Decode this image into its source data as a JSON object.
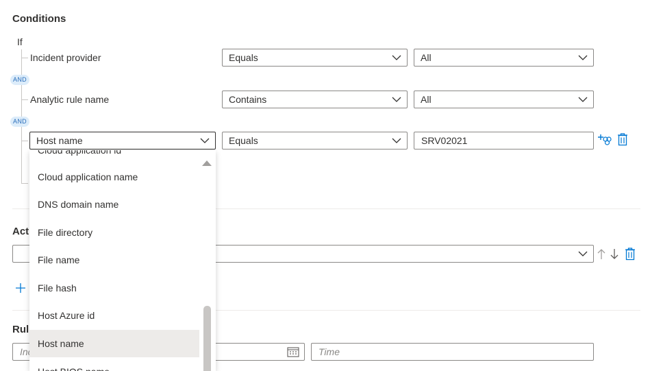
{
  "conditions": {
    "title": "Conditions",
    "if_label": "If",
    "and_label": "AND",
    "rows": [
      {
        "field": "Incident provider",
        "operator": "Equals",
        "value": "All"
      },
      {
        "field": "Analytic rule name",
        "operator": "Contains",
        "value": "All"
      },
      {
        "field": "Host name",
        "operator": "Equals",
        "value": "SRV02021"
      }
    ]
  },
  "actions": {
    "title_partial": "Acti"
  },
  "rule": {
    "title_partial": "Rul",
    "date_placeholder_partial": "Inc",
    "time_placeholder": "Time"
  },
  "dropdown": {
    "items": [
      "Cloud application id",
      "Cloud application name",
      "DNS domain name",
      "File directory",
      "File name",
      "File hash",
      "Host Azure id",
      "Host name",
      "Host BIOS name"
    ],
    "selected": "Host name"
  },
  "colors": {
    "accent": "#0078d4",
    "badge_bg": "#dcecfa",
    "badge_text": "#2a6ebb",
    "selected_item_bg": "#edebe9"
  }
}
